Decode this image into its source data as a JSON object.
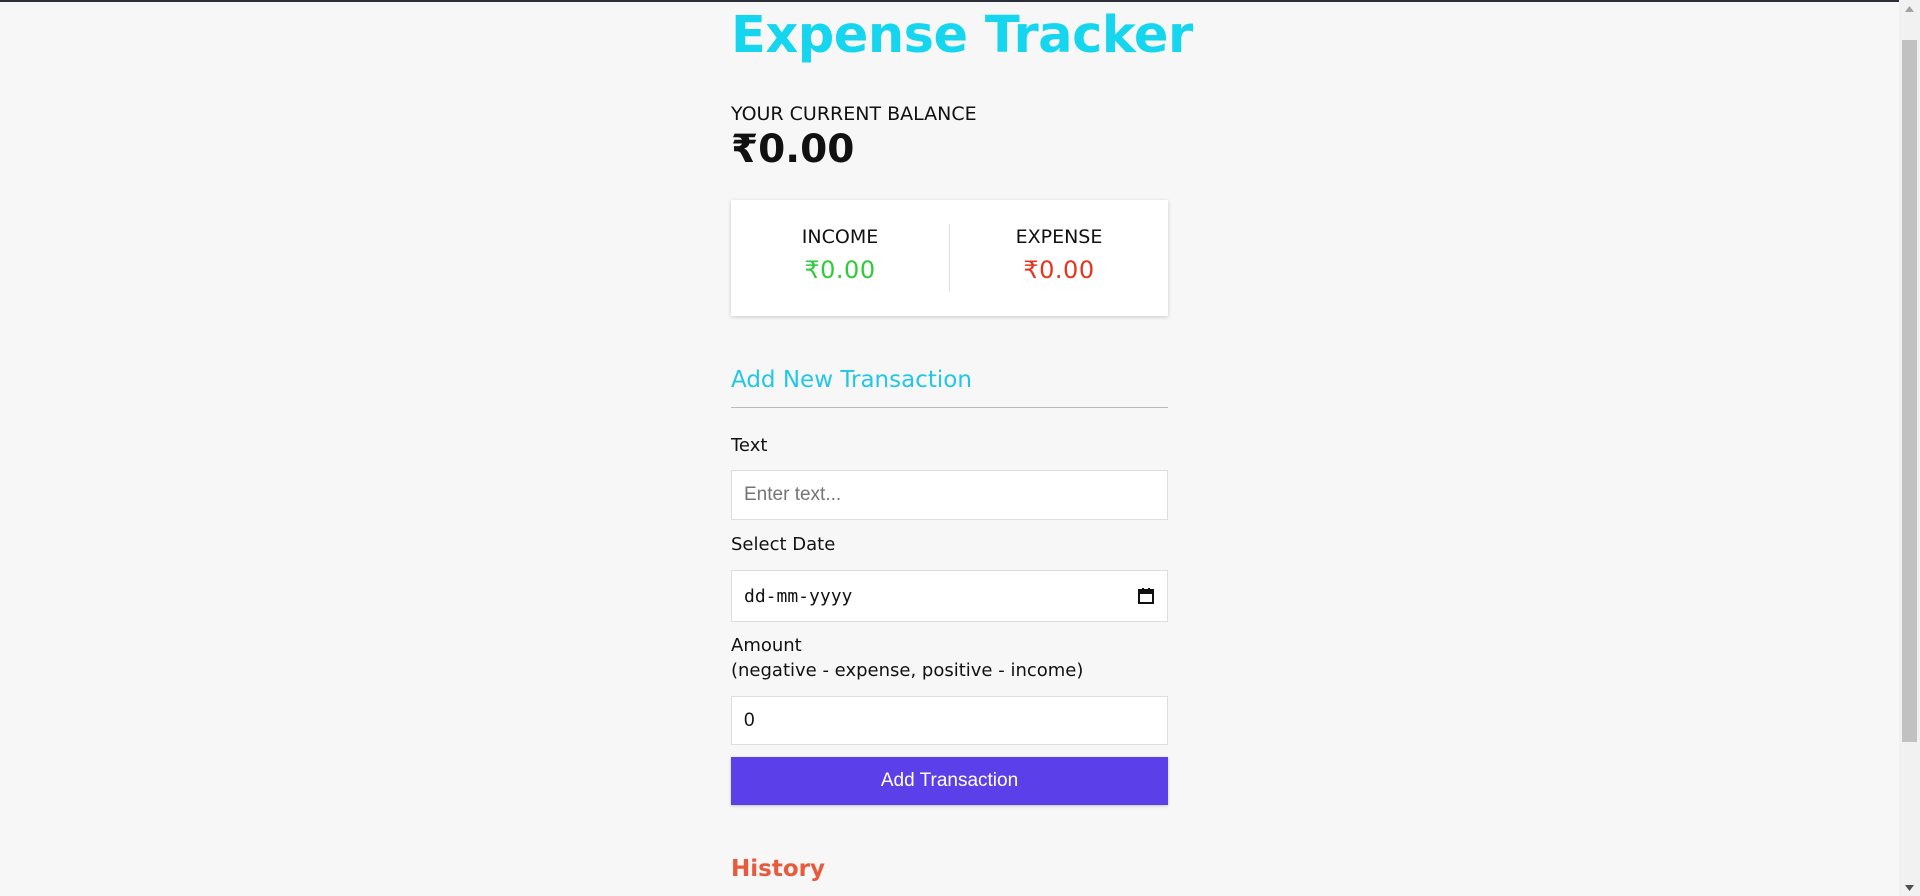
{
  "app": {
    "title": "Expense Tracker"
  },
  "balance": {
    "label": "YOUR CURRENT BALANCE",
    "value": "₹0.00"
  },
  "summary": {
    "income_label": "INCOME",
    "income_value": "₹0.00",
    "expense_label": "EXPENSE",
    "expense_value": "₹0.00"
  },
  "form": {
    "heading": "Add New Transaction",
    "text_label": "Text",
    "text_placeholder": "Enter text...",
    "date_label": "Select Date",
    "date_placeholder": "dd-mm-yyyy",
    "amount_label": "Amount",
    "amount_hint": "(negative - expense, positive - income)",
    "amount_value": "0",
    "submit_label": "Add Transaction"
  },
  "history": {
    "heading": "History"
  },
  "colors": {
    "title": "#15d6ee",
    "income": "#2ecc3a",
    "expense": "#e8331f",
    "button": "#5b40ea",
    "history": "#e85a3c"
  },
  "icons": {
    "date_picker": "calendar-icon",
    "scroll_up": "chevron-up-icon",
    "scroll_down": "chevron-down-icon"
  }
}
